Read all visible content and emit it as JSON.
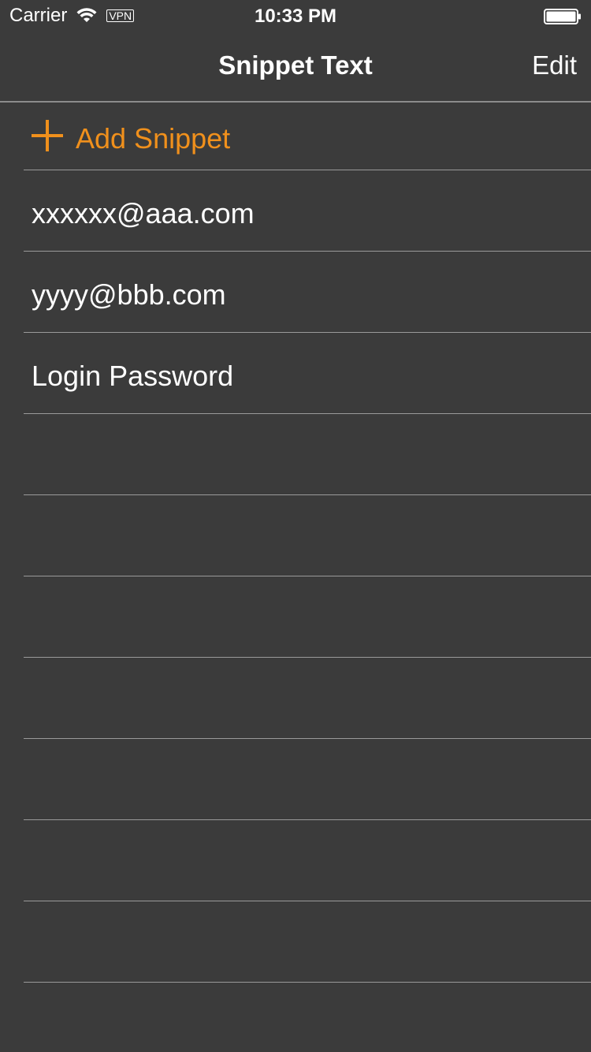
{
  "status_bar": {
    "carrier": "Carrier",
    "vpn": "VPN",
    "time": "10:33 PM",
    "icons": [
      "wifi-icon",
      "battery-icon"
    ]
  },
  "nav": {
    "title": "Snippet Text",
    "edit_label": "Edit"
  },
  "list": {
    "add_label": "Add Snippet",
    "add_icon": "plus-icon",
    "accent_color": "#f0901c",
    "items": [
      {
        "label": "xxxxxx@aaa.com"
      },
      {
        "label": "yyyy@bbb.com"
      },
      {
        "label": "Login Password"
      },
      {
        "label": ""
      },
      {
        "label": ""
      },
      {
        "label": ""
      },
      {
        "label": ""
      },
      {
        "label": ""
      },
      {
        "label": ""
      },
      {
        "label": ""
      }
    ]
  },
  "colors": {
    "background": "#3b3b3b",
    "separator": "#9a9a9a",
    "text": "#ffffff"
  }
}
